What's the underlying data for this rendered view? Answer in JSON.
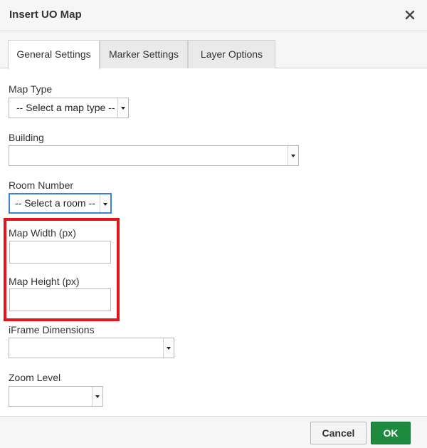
{
  "dialog": {
    "title": "Insert UO Map"
  },
  "tabs": [
    {
      "label": "General Settings",
      "active": true
    },
    {
      "label": "Marker Settings",
      "active": false
    },
    {
      "label": "Layer Options",
      "active": false
    }
  ],
  "form": {
    "map_type": {
      "label": "Map Type",
      "value": "-- Select a map type --"
    },
    "building": {
      "label": "Building",
      "value": ""
    },
    "room_number": {
      "label": "Room Number",
      "value": "-- Select a room --"
    },
    "map_width": {
      "label": "Map Width (px)",
      "value": ""
    },
    "map_height": {
      "label": "Map Height (px)",
      "value": ""
    },
    "iframe_dimensions": {
      "label": "iFrame Dimensions",
      "value": ""
    },
    "zoom_level": {
      "label": "Zoom Level",
      "value": ""
    }
  },
  "footer": {
    "cancel_label": "Cancel",
    "ok_label": "OK"
  },
  "colors": {
    "highlight": "#e0161b",
    "ok_button": "#1e8a3e",
    "focus_border": "#3b82d6"
  },
  "icons": {
    "close": "close-icon",
    "dropdown": "chevron-down-icon"
  }
}
